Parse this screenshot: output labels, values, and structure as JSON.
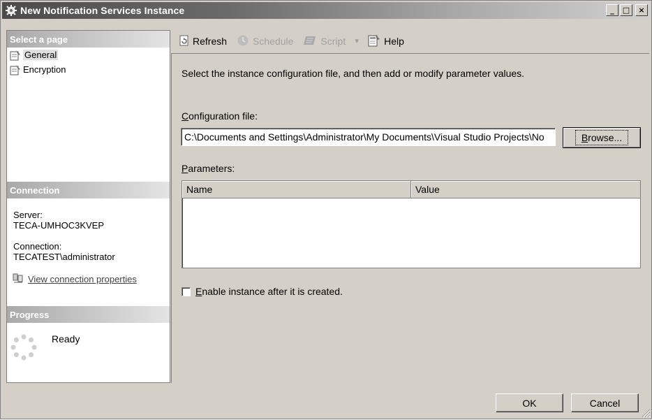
{
  "window": {
    "title": "New Notification Services Instance",
    "minimize": "_",
    "maximize": "□",
    "close": "×"
  },
  "left": {
    "select_page_header": "Select a page",
    "pages": [
      {
        "label": "General",
        "icon": "page-icon",
        "selected": true
      },
      {
        "label": "Encryption",
        "icon": "page-icon",
        "selected": false
      }
    ],
    "connection_header": "Connection",
    "server_label": "Server:",
    "server_value": "TECA-UMHOC3KVEP",
    "connection_label": "Connection:",
    "connection_value": "TECATEST\\administrator",
    "view_props_link": "View connection properties",
    "progress_header": "Progress",
    "progress_status": "Ready"
  },
  "toolbar": {
    "refresh": "Refresh",
    "schedule": "Schedule",
    "script": "Script",
    "help": "Help"
  },
  "main": {
    "instruction": "Select the instance configuration file, and then add or modify parameter values.",
    "config_label_first": "C",
    "config_label_rest": "onfiguration file:",
    "config_value": "C:\\Documents and Settings\\Administrator\\My Documents\\Visual Studio Projects\\No",
    "browse_first": "B",
    "browse_rest": "rowse...",
    "params_label_first": "P",
    "params_label_rest": "arameters:",
    "columns": [
      "Name",
      "Value"
    ],
    "enable_first": "E",
    "enable_rest": "nable instance after it is created."
  },
  "footer": {
    "ok": "OK",
    "cancel": "Cancel"
  },
  "colors": {
    "face": "#d4d0c8",
    "title_start": "#4b4b4b",
    "title_end": "#d0d0d0"
  }
}
